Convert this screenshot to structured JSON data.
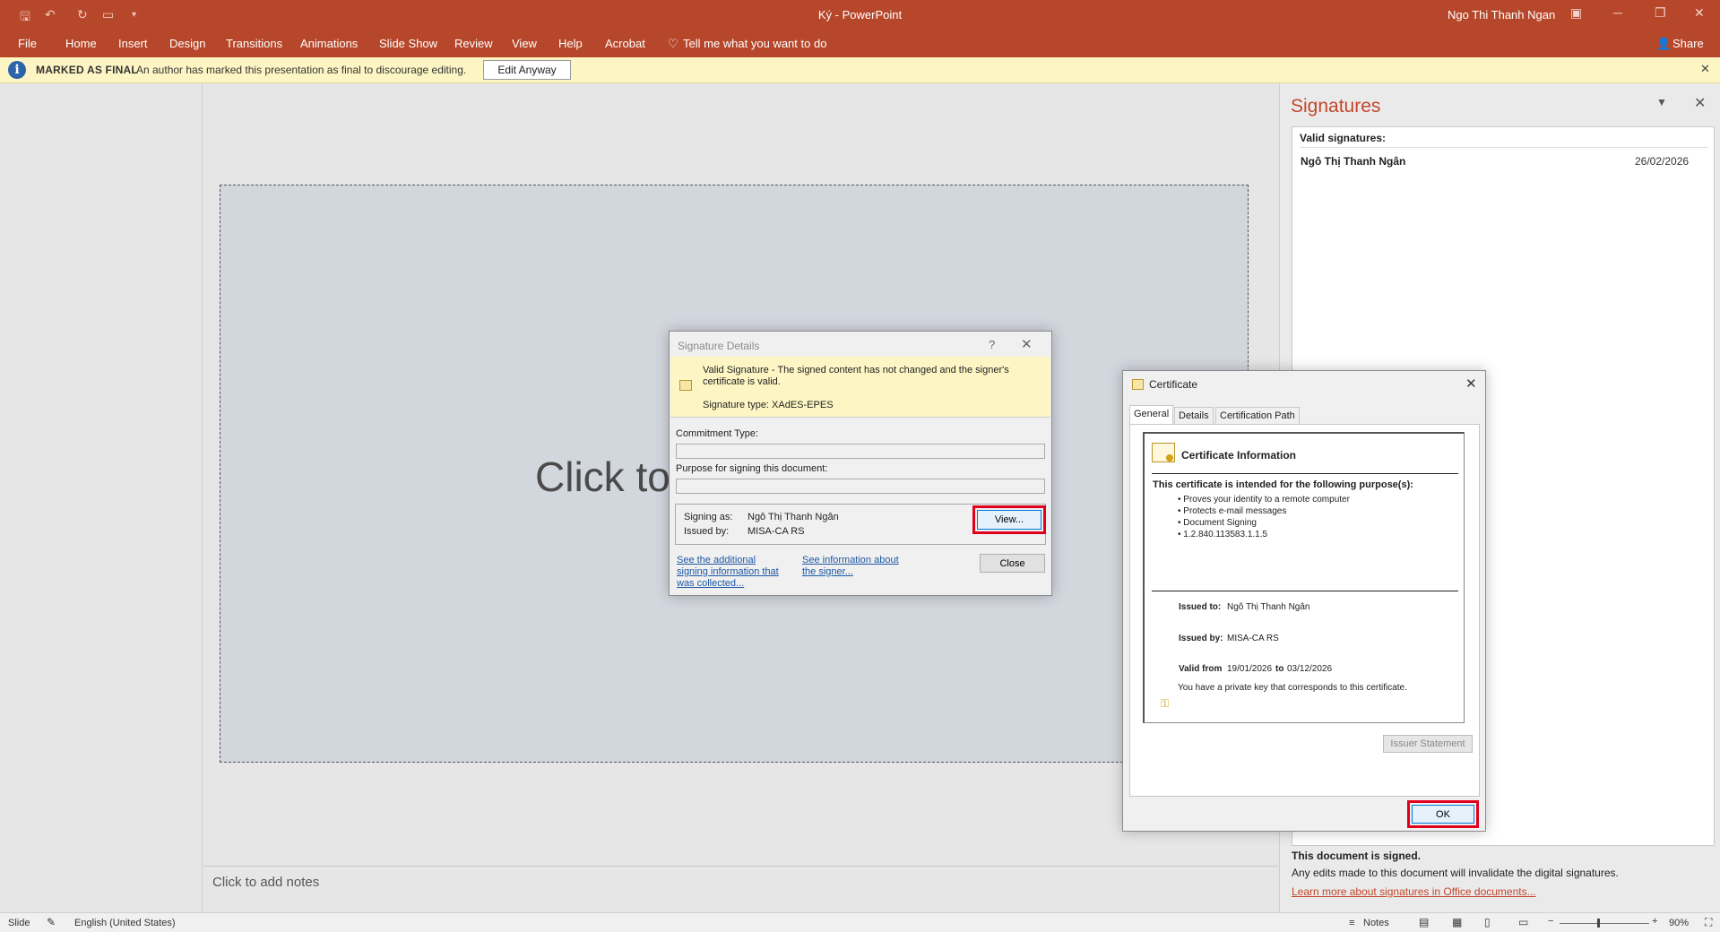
{
  "titlebar": {
    "doc_title": "Ký  -  PowerPoint",
    "user": "Ngo Thi Thanh Ngan",
    "share": "Share"
  },
  "ribbon": {
    "tabs": [
      "File",
      "Home",
      "Insert",
      "Design",
      "Transitions",
      "Animations",
      "Slide Show",
      "Review",
      "View",
      "Help",
      "Acrobat"
    ],
    "tell_me": "Tell me what you want to do"
  },
  "infobar": {
    "title": "MARKED AS FINAL",
    "message": "An author has marked this presentation as final to discourage editing.",
    "button": "Edit Anyway"
  },
  "slide": {
    "title_placeholder": "Click to add title"
  },
  "notes": {
    "placeholder": "Click to add notes"
  },
  "signatures_pane": {
    "title": "Signatures",
    "valid_heading": "Valid signatures:",
    "signer": "Ngô Thị Thanh Ngân",
    "date": "26/02/2026",
    "signed_text": "This document is signed.",
    "edits_text": "Any edits made to this document will invalidate the digital signatures.",
    "learn_more": "Learn more about signatures in Office documents..."
  },
  "statusbar": {
    "slide": "Slide",
    "language": "English (United States)",
    "notes": "Notes",
    "zoom": "90%",
    "zoom_level": 0.43
  },
  "signature_dialog": {
    "title": "Signature Details",
    "banner_text": "Valid Signature - The signed content has not changed and the signer's certificate is valid.",
    "signature_type": "Signature type: XAdES-EPES",
    "commitment_label": "Commitment Type:",
    "purpose_label": "Purpose for signing this document:",
    "signing_as_label": "Signing as:",
    "signing_as": "Ngô Thị Thanh Ngân",
    "issued_by_label": "Issued by:",
    "issued_by": "MISA-CA RS",
    "view_button": "View...",
    "link_additional": "See the additional signing information that was collected...",
    "link_signer": "See information about the signer...",
    "close_button": "Close"
  },
  "certificate_dialog": {
    "title": "Certificate",
    "tabs": [
      "General",
      "Details",
      "Certification Path"
    ],
    "info_heading": "Certificate Information",
    "purpose_heading": "This certificate is intended for the following purpose(s):",
    "purposes": [
      "Proves your identity to a remote computer",
      "Protects e-mail messages",
      "Document Signing",
      "1.2.840.113583.1.1.5"
    ],
    "issued_to_label": "Issued to:",
    "issued_to": "Ngô Thị Thanh Ngân",
    "issued_by_label": "Issued by:",
    "issued_by": "MISA-CA RS",
    "valid_from_label": "Valid from",
    "valid_from": "19/01/2026",
    "to_label": "to",
    "valid_to": "03/12/2026",
    "private_key_text": "You have a private key that corresponds to this certificate.",
    "issuer_statement": "Issuer Statement",
    "ok_button": "OK"
  }
}
